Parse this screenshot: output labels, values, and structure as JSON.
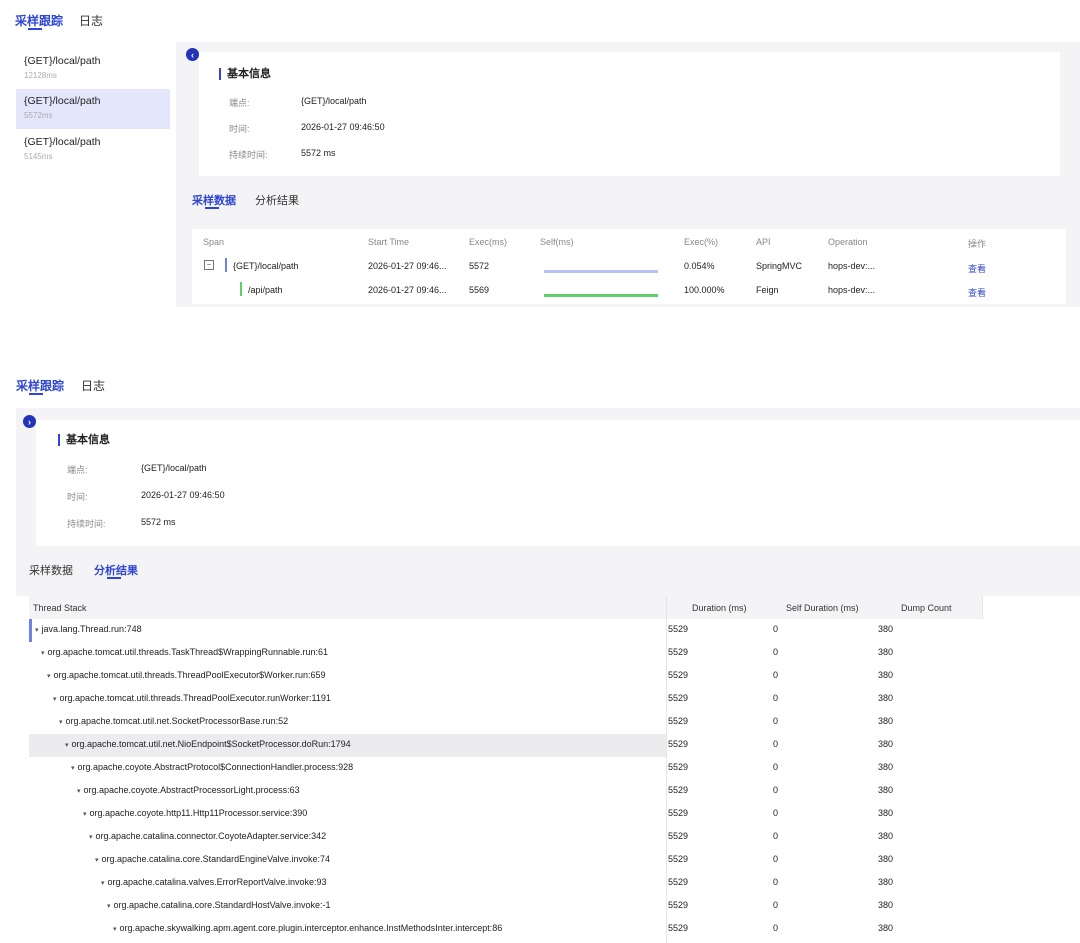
{
  "tabs": [
    {
      "label": "采样跟踪",
      "active": true
    },
    {
      "label": "日志",
      "active": false
    }
  ],
  "sample_list": [
    {
      "path": "{GET}/local/path",
      "time": "12128ms"
    },
    {
      "path": "{GET}/local/path",
      "time": "5572ms",
      "selected": true
    },
    {
      "path": "{GET}/local/path",
      "time": "5145ms"
    }
  ],
  "basic_info": {
    "title": "基本信息",
    "endpoint_label": "端点:",
    "endpoint_value": "{GET}/local/path",
    "time_label": "时间:",
    "time_value": "2026-01-27 09:46:50",
    "duration_label": "持续时间:",
    "duration_value": "5572 ms"
  },
  "sub_tabs": [
    {
      "label": "采样数据"
    },
    {
      "label": "分析结果"
    }
  ],
  "span_table": {
    "headers": [
      "Span",
      "Start Time",
      "Exec(ms)",
      "Self(ms)",
      "Exec(%)",
      "API",
      "Operation",
      "操作"
    ],
    "rows": [
      {
        "span": "{GET}/local/path",
        "start": "2026-01-27 09:46...",
        "exec": "5572",
        "self_fraction": 1.0,
        "pct": "0.054%",
        "api": "SpringMVC",
        "op": "hops-dev:...",
        "action": "查看",
        "color": "#b7c4f3",
        "marker": "#6f82e8"
      },
      {
        "span": "/api/path",
        "start": "2026-01-27 09:46...",
        "exec": "5569",
        "self_fraction": 1.0,
        "pct": "100.000%",
        "api": "Feign",
        "op": "hops-dev:...",
        "action": "查看",
        "color": "#5cd16a",
        "marker": "#5cd16a"
      }
    ]
  },
  "thread_table": {
    "headers": [
      "Thread Stack",
      "Duration (ms)",
      "Self Duration (ms)",
      "Dump Count"
    ],
    "rows": [
      {
        "name": "java.lang.Thread.run:748",
        "duration": "5529",
        "self": "0",
        "count": "380"
      },
      {
        "name": "org.apache.tomcat.util.threads.TaskThread$WrappingRunnable.run:61",
        "duration": "5529",
        "self": "0",
        "count": "380"
      },
      {
        "name": "org.apache.tomcat.util.threads.ThreadPoolExecutor$Worker.run:659",
        "duration": "5529",
        "self": "0",
        "count": "380"
      },
      {
        "name": "org.apache.tomcat.util.threads.ThreadPoolExecutor.runWorker:1191",
        "duration": "5529",
        "self": "0",
        "count": "380"
      },
      {
        "name": "org.apache.tomcat.util.net.SocketProcessorBase.run:52",
        "duration": "5529",
        "self": "0",
        "count": "380"
      },
      {
        "name": "org.apache.tomcat.util.net.NioEndpoint$SocketProcessor.doRun:1794",
        "duration": "5529",
        "self": "0",
        "count": "380",
        "highlight": true
      },
      {
        "name": "org.apache.coyote.AbstractProtocol$ConnectionHandler.process:928",
        "duration": "5529",
        "self": "0",
        "count": "380"
      },
      {
        "name": "org.apache.coyote.AbstractProcessorLight.process:63",
        "duration": "5529",
        "self": "0",
        "count": "380"
      },
      {
        "name": "org.apache.coyote.http11.Http11Processor.service:390",
        "duration": "5529",
        "self": "0",
        "count": "380"
      },
      {
        "name": "org.apache.catalina.connector.CoyoteAdapter.service:342",
        "duration": "5529",
        "self": "0",
        "count": "380"
      },
      {
        "name": "org.apache.catalina.core.StandardEngineValve.invoke:74",
        "duration": "5529",
        "self": "0",
        "count": "380"
      },
      {
        "name": "org.apache.catalina.valves.ErrorReportValve.invoke:93",
        "duration": "5529",
        "self": "0",
        "count": "380"
      },
      {
        "name": "org.apache.catalina.core.StandardHostValve.invoke:-1",
        "duration": "5529",
        "self": "0",
        "count": "380"
      },
      {
        "name": "org.apache.skywalking.apm.agent.core.plugin.interceptor.enhance.InstMethodsInter.intercept:86",
        "duration": "5529",
        "self": "0",
        "count": "380"
      }
    ]
  },
  "colors": {
    "accent": "#2f45d4",
    "collapse_btn": "#2433b8"
  }
}
